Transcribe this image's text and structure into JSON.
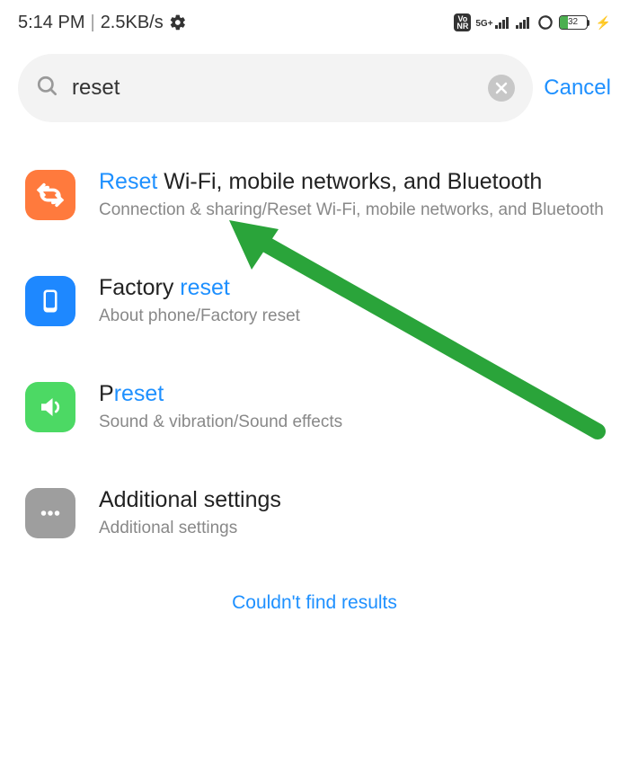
{
  "status": {
    "time": "5:14 PM",
    "speed": "2.5KB/s",
    "vonr": "Vo\nNR",
    "network_label": "5G+",
    "battery_pct": "32"
  },
  "search": {
    "query": "reset",
    "cancel_label": "Cancel"
  },
  "results": [
    {
      "title_prefix_hl": "Reset",
      "title_suffix": " Wi-Fi, mobile networks, and Bluetooth",
      "subtitle": "Connection & sharing/Reset Wi-Fi, mobile networks, and Bluetooth",
      "icon": "sync",
      "color": "orange"
    },
    {
      "title_prefix": "Factory ",
      "title_suffix_hl": "reset",
      "subtitle": "About phone/Factory reset",
      "icon": "phone",
      "color": "blue"
    },
    {
      "title_prefix": "P",
      "title_suffix_hl": "reset",
      "subtitle": "Sound & vibration/Sound effects",
      "icon": "speaker",
      "color": "green"
    },
    {
      "title_plain": "Additional settings",
      "subtitle": "Additional settings",
      "icon": "dots",
      "color": "gray"
    }
  ],
  "footer": "Couldn't find results"
}
